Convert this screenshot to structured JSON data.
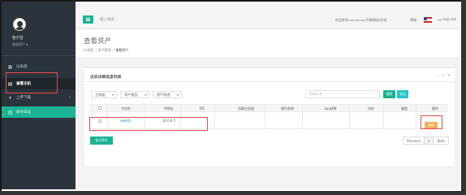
{
  "sidebar": {
    "user_name": "管宁堂",
    "user_role": "普通用户 ▾",
    "items": [
      {
        "label": "仪表盘"
      },
      {
        "label": "查看主机"
      },
      {
        "label": "上传下载"
      },
      {
        "label": "命令日志"
      }
    ]
  },
  "topbar": {
    "search_placeholder": "输入搜索...",
    "welcome": "欢迎使用Jumpserver开源跳板机系统",
    "help": "帮助",
    "logout": "Log out"
  },
  "page": {
    "title": "查看资产",
    "breadcrumbs": [
      "仪表盘",
      "资产管理",
      "查看资产"
    ]
  },
  "panel": {
    "title": "主机详细信息列表",
    "tools": "⌄ ⤢ ✕",
    "filters": [
      "主机组",
      "资产类型",
      "资产状态"
    ],
    "search_placeholder": "Search",
    "search_button": "搜索",
    "export_button": "导出"
  },
  "table": {
    "headers": [
      "主机名",
      "IP地址",
      "IDC",
      "所属主机组",
      "操作系统",
      "cpu核数",
      "内存",
      "硬盘",
      "操作"
    ],
    "rows": [
      {
        "hostname": "web01",
        "ip": "10.0.0.7",
        "action": "编辑"
      }
    ]
  },
  "footer": {
    "run_button": "执行命令",
    "pager": {
      "previous": "Previous",
      "page": "1",
      "next": "Next"
    }
  },
  "colors": {
    "accent": "#1ab394",
    "sidebar": "#2b333c",
    "warning": "#f8ac59",
    "highlight": "#e84a4a"
  }
}
